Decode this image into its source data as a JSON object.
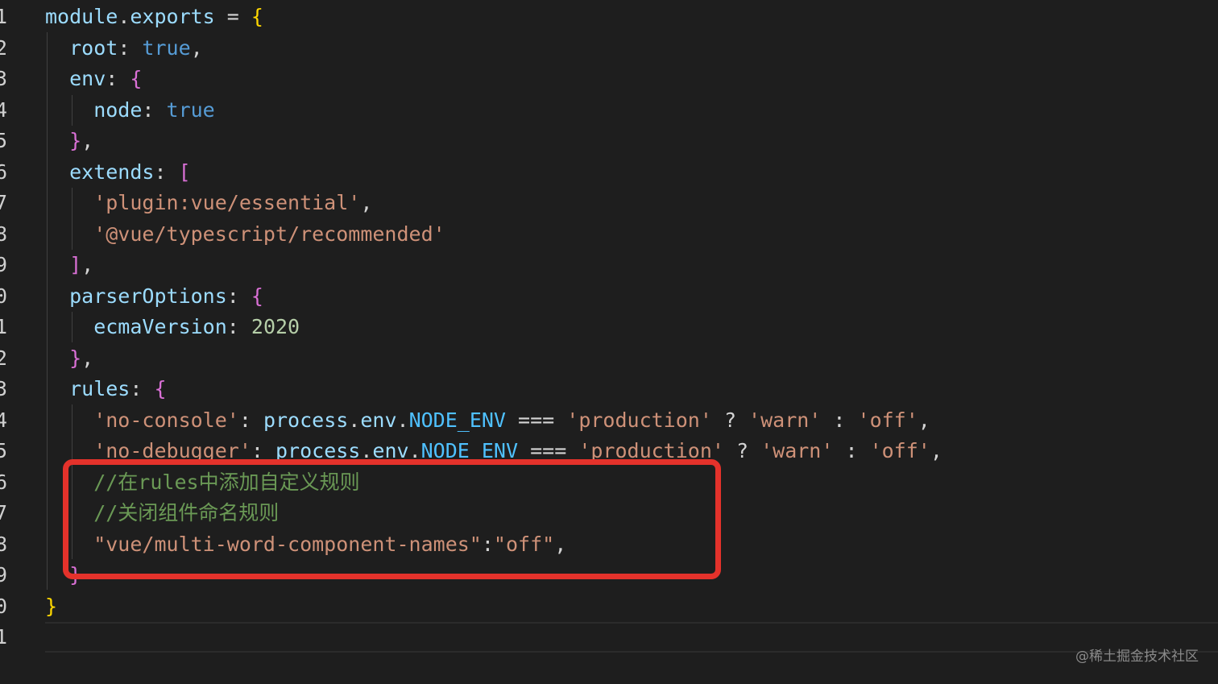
{
  "lines": [
    {
      "num": "1",
      "tokens": [
        [
          "tok-plain",
          "module"
        ],
        [
          "tok-op",
          "."
        ],
        [
          "tok-plain",
          "exports"
        ],
        [
          "tok-op",
          " = "
        ],
        [
          "tok-brace1",
          "{"
        ]
      ]
    },
    {
      "num": "2",
      "tokens": [
        [
          "tok-plain",
          "  root"
        ],
        [
          "tok-op",
          ": "
        ],
        [
          "tok-bool",
          "true"
        ],
        [
          "tok-op",
          ","
        ]
      ]
    },
    {
      "num": "3",
      "tokens": [
        [
          "tok-plain",
          "  env"
        ],
        [
          "tok-op",
          ": "
        ],
        [
          "tok-brace2",
          "{"
        ]
      ]
    },
    {
      "num": "4",
      "tokens": [
        [
          "tok-plain",
          "    node"
        ],
        [
          "tok-op",
          ": "
        ],
        [
          "tok-bool",
          "true"
        ]
      ]
    },
    {
      "num": "5",
      "tokens": [
        [
          "tok-brace2",
          "  }"
        ],
        [
          "tok-op",
          ","
        ]
      ]
    },
    {
      "num": "6",
      "tokens": [
        [
          "tok-plain",
          "  extends"
        ],
        [
          "tok-op",
          ": "
        ],
        [
          "tok-brace2",
          "["
        ]
      ]
    },
    {
      "num": "7",
      "tokens": [
        [
          "tok-str",
          "    'plugin:vue/essential'"
        ],
        [
          "tok-op",
          ","
        ]
      ]
    },
    {
      "num": "8",
      "tokens": [
        [
          "tok-str",
          "    '@vue/typescript/recommended'"
        ]
      ]
    },
    {
      "num": "9",
      "tokens": [
        [
          "tok-brace2",
          "  ]"
        ],
        [
          "tok-op",
          ","
        ]
      ]
    },
    {
      "num": "0",
      "tokens": [
        [
          "tok-plain",
          "  parserOptions"
        ],
        [
          "tok-op",
          ": "
        ],
        [
          "tok-brace2",
          "{"
        ]
      ]
    },
    {
      "num": "1",
      "tokens": [
        [
          "tok-plain",
          "    ecmaVersion"
        ],
        [
          "tok-op",
          ": "
        ],
        [
          "tok-num",
          "2020"
        ]
      ]
    },
    {
      "num": "2",
      "tokens": [
        [
          "tok-brace2",
          "  }"
        ],
        [
          "tok-op",
          ","
        ]
      ]
    },
    {
      "num": "3",
      "tokens": [
        [
          "tok-plain",
          "  rules"
        ],
        [
          "tok-op",
          ": "
        ],
        [
          "tok-brace2",
          "{"
        ]
      ]
    },
    {
      "num": "4",
      "tokens": [
        [
          "tok-str",
          "    'no-console'"
        ],
        [
          "tok-op",
          ": "
        ],
        [
          "tok-plain",
          "process"
        ],
        [
          "tok-op",
          "."
        ],
        [
          "tok-plain",
          "env"
        ],
        [
          "tok-op",
          "."
        ],
        [
          "tok-const",
          "NODE_ENV"
        ],
        [
          "tok-op",
          " === "
        ],
        [
          "tok-str",
          "'production'"
        ],
        [
          "tok-op",
          " ? "
        ],
        [
          "tok-str",
          "'warn'"
        ],
        [
          "tok-op",
          " : "
        ],
        [
          "tok-str",
          "'off'"
        ],
        [
          "tok-op",
          ","
        ]
      ]
    },
    {
      "num": "5",
      "tokens": [
        [
          "tok-str",
          "    'no-debugger'"
        ],
        [
          "tok-op",
          ": "
        ],
        [
          "tok-plain",
          "process"
        ],
        [
          "tok-op",
          "."
        ],
        [
          "tok-plain",
          "env"
        ],
        [
          "tok-op",
          "."
        ],
        [
          "tok-const",
          "NODE_ENV"
        ],
        [
          "tok-op",
          " === "
        ],
        [
          "tok-str",
          "'production'"
        ],
        [
          "tok-op",
          " ? "
        ],
        [
          "tok-str",
          "'warn'"
        ],
        [
          "tok-op",
          " : "
        ],
        [
          "tok-str",
          "'off'"
        ],
        [
          "tok-op",
          ","
        ]
      ]
    },
    {
      "num": "6",
      "tokens": [
        [
          "tok-comment",
          "    //在rules中添加自定义规则"
        ]
      ]
    },
    {
      "num": "7",
      "tokens": [
        [
          "tok-comment",
          "    //关闭组件命名规则"
        ]
      ]
    },
    {
      "num": "8",
      "tokens": [
        [
          "tok-str",
          "    \"vue/multi-word-component-names\""
        ],
        [
          "tok-op",
          ":"
        ],
        [
          "tok-str",
          "\"off\""
        ],
        [
          "tok-op",
          ","
        ]
      ]
    },
    {
      "num": "9",
      "tokens": [
        [
          "tok-brace2",
          "  }"
        ]
      ]
    },
    {
      "num": "0",
      "tokens": [
        [
          "tok-brace1",
          "}"
        ]
      ]
    },
    {
      "num": "1",
      "tokens": []
    }
  ],
  "watermark": "@稀土掘金技术社区",
  "colors": {
    "background": "#1e1e1e",
    "highlight_box": "#e4322b"
  }
}
